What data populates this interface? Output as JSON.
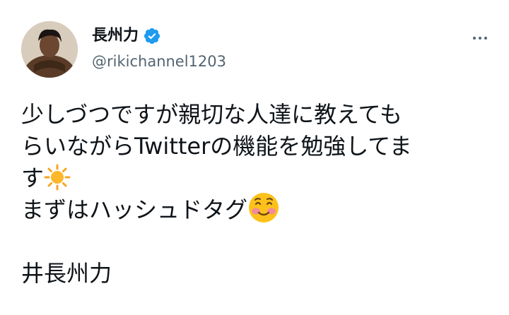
{
  "author": {
    "display_name": "長州力",
    "handle": "@rikichannel1203",
    "avatar_icon": "user-avatar-photo",
    "verified_icon": "verified-badge-icon",
    "verified_color": "#1d9bf0"
  },
  "menu": {
    "icon": "more-options-icon"
  },
  "tweet": {
    "line1": "少しづつですが親切な人達に教えても",
    "line2": "らいながらTwitterの機能を勉強してま",
    "line3": "す",
    "line3_emoji": "sun-emoji",
    "line4": "まずはハッシュドタグ",
    "line4_emoji": "smiling-face-emoji",
    "hashtag": "井長州力"
  },
  "colors": {
    "text": "#0f1419",
    "secondary": "#536471",
    "background": "#ffffff"
  }
}
